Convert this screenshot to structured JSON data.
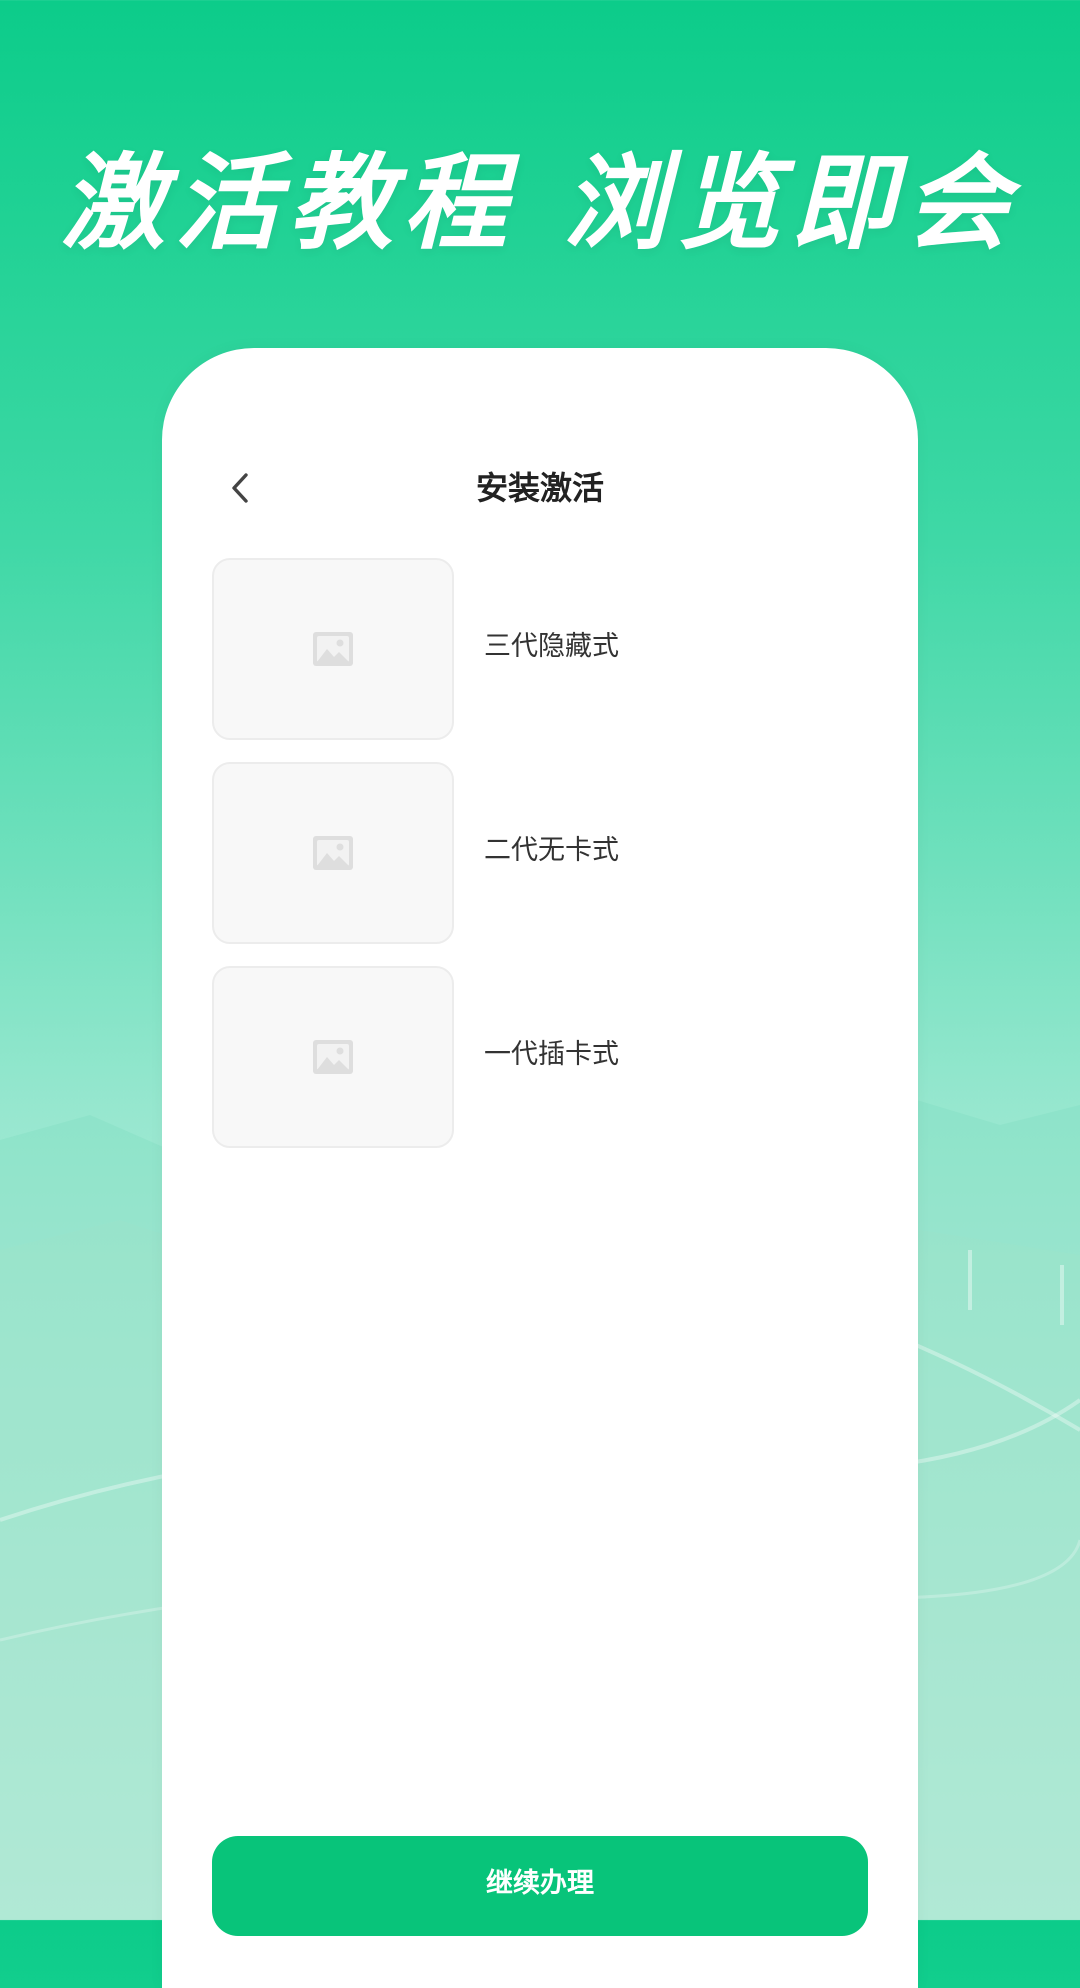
{
  "headline": "激活教程 浏览即会",
  "page": {
    "title": "安装激活",
    "back_icon": "chevron-left-icon"
  },
  "items": [
    {
      "label": "三代隐藏式",
      "icon": "image-placeholder-icon"
    },
    {
      "label": "二代无卡式",
      "icon": "image-placeholder-icon"
    },
    {
      "label": "一代插卡式",
      "icon": "image-placeholder-icon"
    }
  ],
  "actions": {
    "continue_label": "继续办理"
  },
  "colors": {
    "accent": "#08c47a",
    "background_top": "#0ccc8a",
    "background_bottom": "#dcf6ec",
    "text_primary": "#222222",
    "placeholder_bg": "#f8f8f8"
  }
}
